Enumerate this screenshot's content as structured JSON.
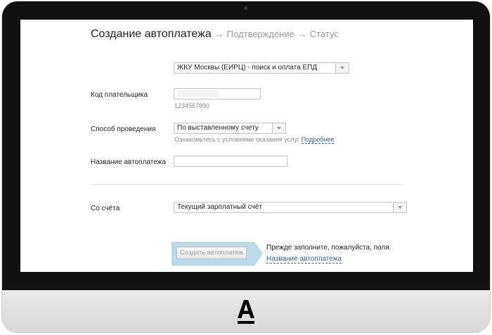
{
  "header": {
    "step_active": "Создание автоплатежа",
    "sep1": "→",
    "step2": "Подтверждение",
    "sep2": "→",
    "step3": "Статус"
  },
  "form": {
    "provider": {
      "value": "ЖКУ Москвы (ЕИРЦ) - поиск и оплата ЕПД"
    },
    "payer_code": {
      "label": "Код плательщика",
      "value": "",
      "hint": "1234567890"
    },
    "method": {
      "label": "Способ проведения",
      "value": "По выставленному счету",
      "hint": "Ознакомьтесь с условиями оказания услуг",
      "hint_link": "Подробнее"
    },
    "autopay_name": {
      "label": "Название автоплатежа",
      "value": ""
    },
    "account": {
      "label": "Со счёта",
      "value": "Текущий зарплатный счёт"
    }
  },
  "submit": {
    "button_label": "Создать автоплатеж",
    "prompt": "Прежде заполните, пожалуйста, поля:",
    "missing_field_link": "Название автоплатежа"
  },
  "brand": {
    "logo": "alfa-bank-logo",
    "accent": "#a9cde0"
  }
}
